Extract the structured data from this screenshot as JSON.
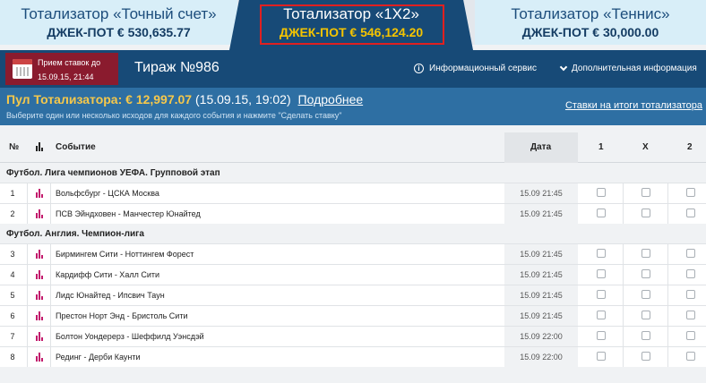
{
  "tabs": [
    {
      "title": "Тотализатор «Точный счет»",
      "jackpot": "ДЖЕК-ПОТ € 530,635.77"
    },
    {
      "title": "Тотализатор «1X2»",
      "jackpot": "ДЖЕК-ПОТ € 546,124.20"
    },
    {
      "title": "Тотализатор «Теннис»",
      "jackpot": "ДЖЕК-ПОТ € 30,000.00"
    }
  ],
  "header": {
    "deadline_label": "Прием ставок до",
    "deadline_time": "15.09.15, 21:44",
    "draw_title": "Тираж №986",
    "info_service": "Информационный сервис",
    "more_info": "Дополнительная информация"
  },
  "pool": {
    "label": "Пул Тотализатора: € 12,997.07",
    "date": "(15.09.15, 19:02)",
    "details_link": "Подробнее",
    "hint": "Выберите один или несколько исходов для каждого события и нажмите \"Сделать ставку\"",
    "bets_link": "Ставки на итоги тотализатора"
  },
  "table": {
    "headers": {
      "num": "№",
      "event": "Событие",
      "date": "Дата",
      "o1": "1",
      "ox": "X",
      "o2": "2"
    },
    "groups": [
      {
        "title": "Футбол. Лига чемпионов УЕФА. Групповой этап",
        "rows": [
          {
            "num": "1",
            "event": "Вольфсбург - ЦСКА Москва",
            "date": "15.09 21:45"
          },
          {
            "num": "2",
            "event": "ПСВ Эйндховен - Манчестер Юнайтед",
            "date": "15.09 21:45"
          }
        ]
      },
      {
        "title": "Футбол. Англия. Чемпион-лига",
        "rows": [
          {
            "num": "3",
            "event": "Бирмингем Сити - Ноттингем Форест",
            "date": "15.09 21:45"
          },
          {
            "num": "4",
            "event": "Кардифф Сити - Халл Сити",
            "date": "15.09 21:45"
          },
          {
            "num": "5",
            "event": "Лидс Юнайтед - Ипсвич Таун",
            "date": "15.09 21:45"
          },
          {
            "num": "6",
            "event": "Престон Норт Энд - Бристоль Сити",
            "date": "15.09 21:45"
          },
          {
            "num": "7",
            "event": "Болтон Уондерерз - Шеффилд Уэнсдэй",
            "date": "15.09 22:00"
          },
          {
            "num": "8",
            "event": "Рединг - Дерби Каунти",
            "date": "15.09 22:00"
          }
        ]
      }
    ]
  },
  "colors": {
    "accent_blue": "#174a77",
    "jackpot_yellow": "#f5c400",
    "deadline_red": "#8a1b2e",
    "stat_pink": "#c2196c"
  }
}
